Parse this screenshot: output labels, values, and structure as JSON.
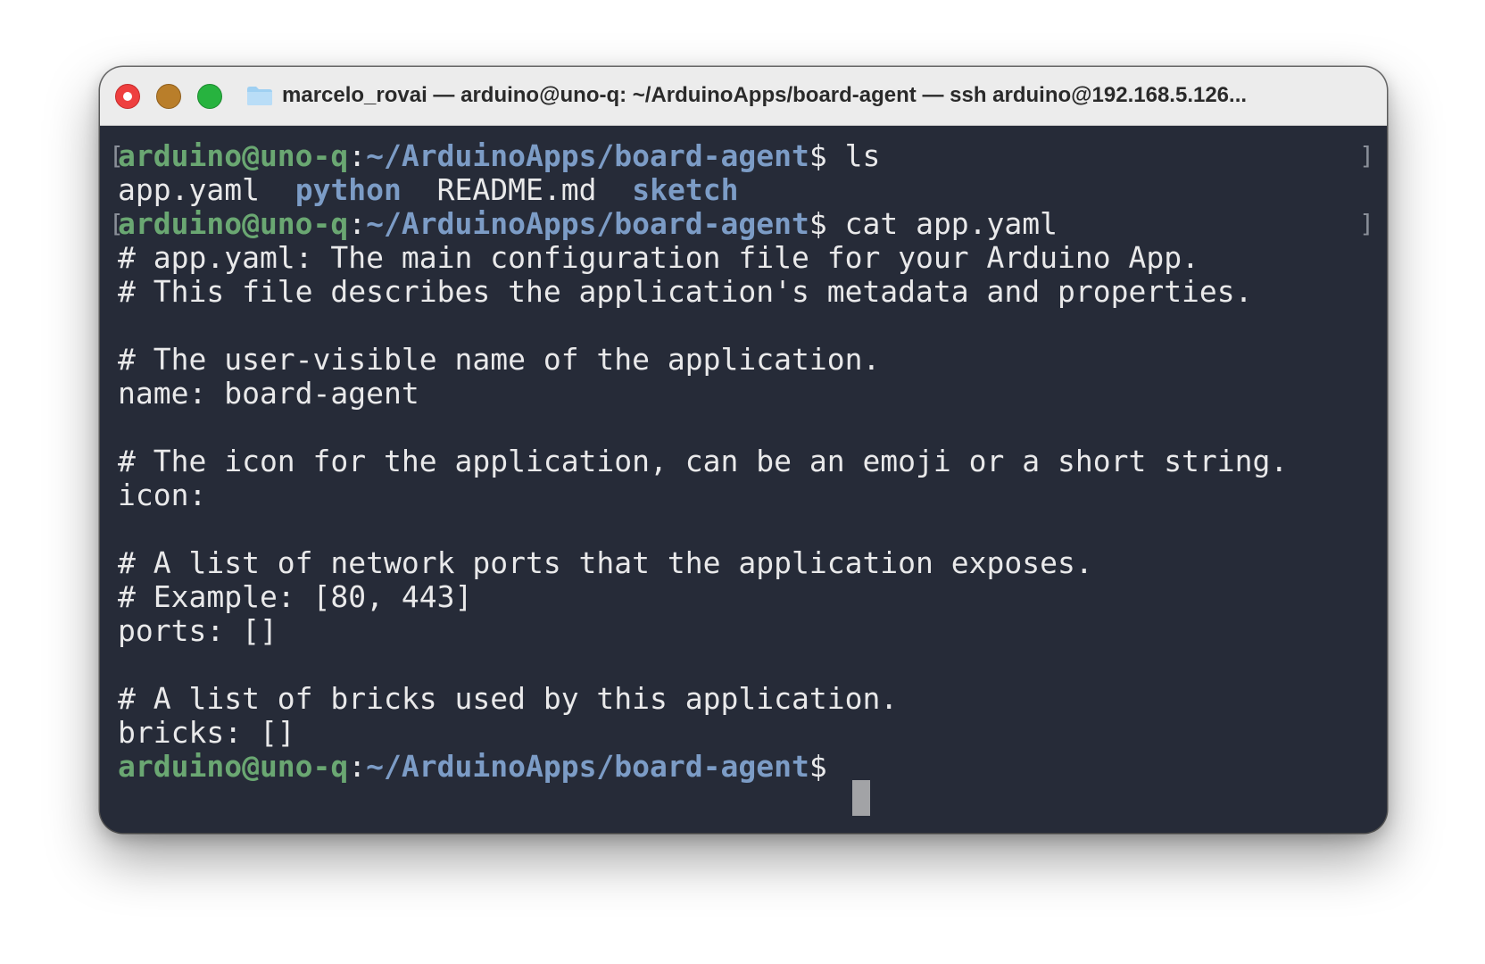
{
  "window": {
    "title": "marcelo_rovai — arduino@uno-q: ~/ArduinoApps/board-agent — ssh arduino@192.168.5.126..."
  },
  "colors": {
    "terminal_background": "#262b38",
    "text": "#e9e9ea",
    "user_host": "#6aa772",
    "path": "#7c9cc6",
    "close_button": "#ee3f3f",
    "minimize_button": "#b97e2a",
    "zoom_button": "#27b33f"
  },
  "icons": {
    "close": "close-icon",
    "minimize": "minimize-icon",
    "zoom": "zoom-icon",
    "folder": "folder-icon"
  },
  "prompt": {
    "user_host": "arduino@uno-q",
    "separator": ":",
    "path": "~/ArduinoApps/board-agent",
    "symbol": "$"
  },
  "terminal": {
    "cmd1": " ls",
    "ls_output": {
      "file1": "app.yaml",
      "dir1": "python",
      "file2": "README.md",
      "dir2": "sketch"
    },
    "cmd2": " cat app.yaml",
    "file_lines": [
      "# app.yaml: The main configuration file for your Arduino App.",
      "# This file describes the application's metadata and properties.",
      "",
      "# The user-visible name of the application.",
      "name: board-agent",
      "",
      "# The icon for the application, can be an emoji or a short string.",
      "icon:",
      "",
      "# A list of network ports that the application exposes.",
      "# Example: [80, 443]",
      "ports: []",
      "",
      "# A list of bricks used by this application.",
      "bricks: []"
    ]
  }
}
